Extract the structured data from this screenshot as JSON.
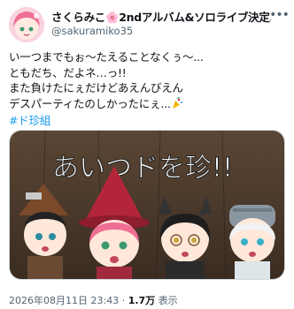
{
  "author": {
    "display_name": "さくらみこ🌸2ndアルバム&ソロライブ決定…",
    "handle": "@sakuramiko35",
    "verified": true,
    "avatar_icon": "avatar-image"
  },
  "tweet": {
    "lines": [
      "い一つまでもぉ〜たえることなくぅ〜...",
      "ともだち、だよネ…っ!!",
      "また負けたにぇだけどあえんびえん",
      "デスパーティたのしかったにぇ..."
    ],
    "hashtag": "#ド珍組",
    "media_caption": "あいつドを珍!!"
  },
  "meta": {
    "date": "2026年08月11日 23:43",
    "separator": "·",
    "views_count": "1.7万",
    "views_label": "表示"
  },
  "colors": {
    "link": "#1d9bf0",
    "verified": "#1d9bf0",
    "secondary_text": "#536471"
  }
}
